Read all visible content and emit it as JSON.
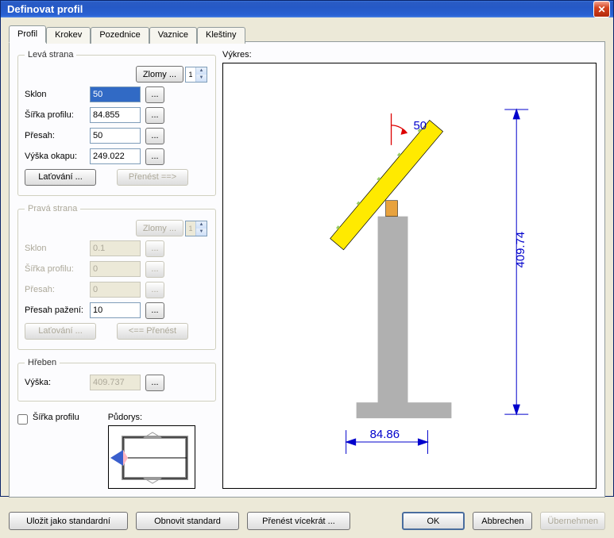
{
  "window": {
    "title": "Definovat profil"
  },
  "tabs": [
    "Profil",
    "Krokev",
    "Pozednice",
    "Vaznice",
    "Kleštiny"
  ],
  "active_tab": 0,
  "left": {
    "leva_strana": {
      "legend": "Levá strana",
      "zlomy_label": "Zlomy ...",
      "zlomy_count": "1",
      "rows": {
        "sklon": {
          "label": "Sklon",
          "value": "50"
        },
        "sirka": {
          "label": "Šířka profilu:",
          "value": "84.855"
        },
        "presah": {
          "label": "Přesah:",
          "value": "50"
        },
        "vyska_okapu": {
          "label": "Výška okapu:",
          "value": "249.022"
        }
      },
      "latovani_label": "Laťování ...",
      "prenest_label": "Přenést ==>"
    },
    "prava_strana": {
      "legend": "Pravá strana",
      "zlomy_label": "Zlomy ...",
      "zlomy_count": "1",
      "rows": {
        "sklon": {
          "label": "Sklon",
          "value": "0.1"
        },
        "sirka": {
          "label": "Šířka profilu:",
          "value": "0"
        },
        "presah": {
          "label": "Přesah:",
          "value": "0"
        },
        "presah_pazeni": {
          "label": "Přesah pažení:",
          "value": "10"
        }
      },
      "latovani_label": "Laťování ...",
      "prenest_label": "<== Přenést"
    },
    "hreben": {
      "legend": "Hřeben",
      "vyska_label": "Výška:",
      "vyska_value": "409.737"
    },
    "sirka_checkbox": "Šířka profilu",
    "pudorys_label": "Půdorys:"
  },
  "vykres_label": "Výkres:",
  "drawing": {
    "angle_label": "50",
    "dim_height": "409.74",
    "dim_width": "84.86"
  },
  "buttons": {
    "ulozit": "Uložit jako standardní",
    "obnovit": "Obnovit standard",
    "prenest_vicekrat": "Přenést vícekrát ...",
    "ok": "OK",
    "cancel": "Abbrechen",
    "apply": "Übernehmen"
  },
  "dots": "..."
}
